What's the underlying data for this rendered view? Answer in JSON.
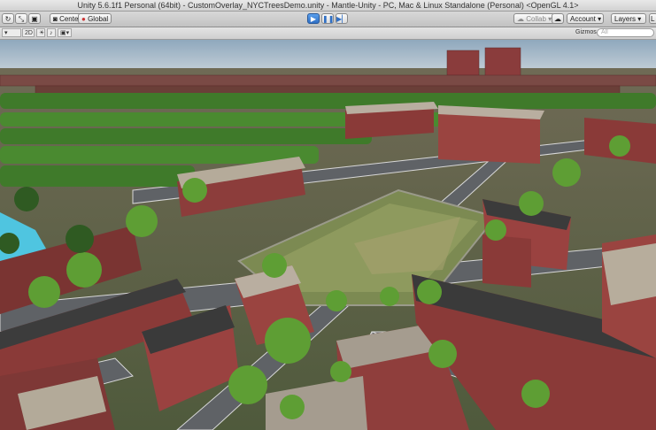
{
  "window": {
    "title": "Unity 5.6.1f1 Personal (64bit) - CustomOverlay_NYCTreesDemo.unity - Mantle-Unity - PC, Mac & Linux Standalone (Personal) <OpenGL 4.1>"
  },
  "toolbar": {
    "pivot_label": "Center",
    "space_label": "Global",
    "collab_label": "Collab",
    "account_label": "Account",
    "layers_label": "Layers",
    "layout_label": "L"
  },
  "scene_toolbar": {
    "shading_mode": "",
    "mode_2d": "2D",
    "gizmos_label": "Gizmos",
    "search_placeholder": "All"
  },
  "icons": [
    "refresh-tool-icon",
    "rect-tool-icon",
    "transform-tool-icon",
    "pivot-icon",
    "globe-icon",
    "play-icon",
    "pause-icon",
    "step-icon",
    "cloud-icon",
    "light-icon",
    "audio-icon",
    "fx-icon"
  ],
  "colors": {
    "accent": "#2f6fc4",
    "toolbar": "#c8c8c8"
  }
}
